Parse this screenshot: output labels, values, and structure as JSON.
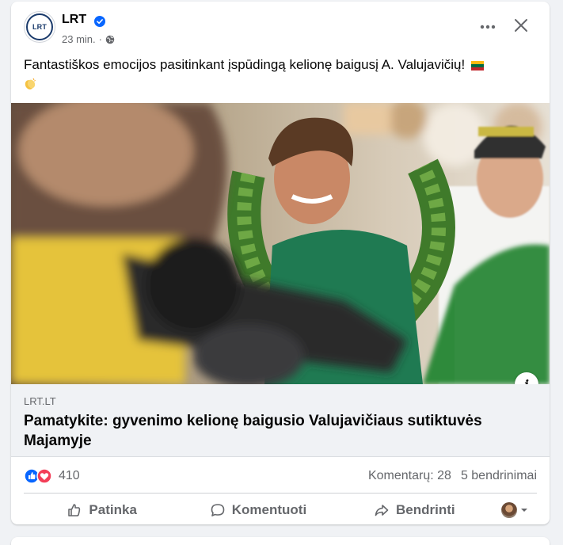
{
  "post": {
    "page_name": "LRT",
    "avatar_text": "LRT",
    "time": "23 min.",
    "separator": "·",
    "text": "Fantastiškos emocijos pasitinkant įspūdingą kelionę baigusį A. Valujavičių!",
    "emoji": [
      "lithuanian-flag",
      "clapping-hands"
    ]
  },
  "link": {
    "domain": "LRT.LT",
    "title": "Pamatykite: gyvenimo kelionę baigusio Valujavičiaus sutiktuvės Majamyje",
    "info_label": "i"
  },
  "stats": {
    "reaction_count": "410",
    "comments": "Komentarų: 28",
    "shares": "5 bendrinimai"
  },
  "actions": {
    "like": "Patinka",
    "comment": "Komentuoti",
    "share": "Bendrinti"
  },
  "colors": {
    "primary_text": "#050505",
    "secondary_text": "#65676b",
    "verified_blue": "#0866ff",
    "like_blue": "#0866ff",
    "love_red": "#f33e58",
    "link_bg": "#f0f2f5"
  },
  "icons": {
    "verified": "verified-badge-icon",
    "audience": "globe-icon",
    "more": "more-options-icon",
    "close": "close-icon",
    "like": "thumbs-up-icon",
    "comment": "speech-bubble-icon",
    "share": "share-arrow-icon"
  }
}
